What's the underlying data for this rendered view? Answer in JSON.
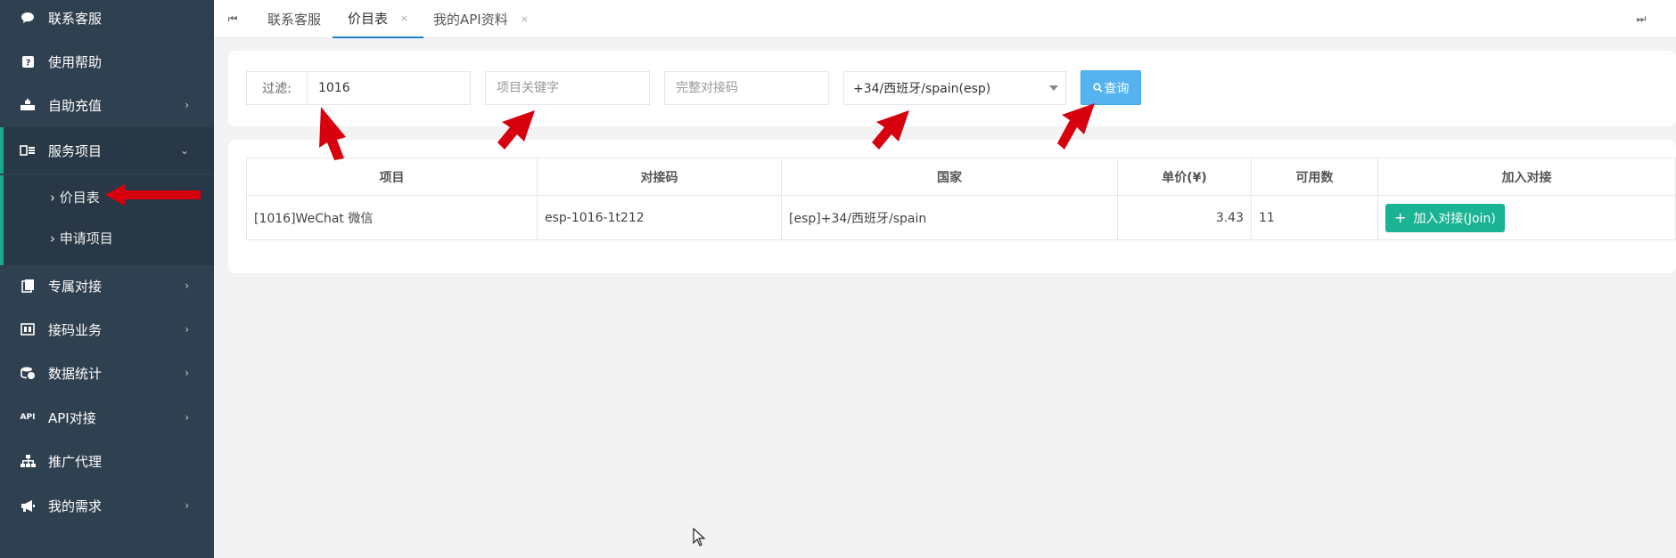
{
  "sidebar": {
    "items": [
      {
        "label": "联系客服",
        "icon": "chat-icon"
      },
      {
        "label": "使用帮助",
        "icon": "help-icon"
      },
      {
        "label": "自助充值",
        "icon": "recharge-icon"
      },
      {
        "label": "服务项目",
        "icon": "service-icon"
      },
      {
        "label": "专属对接",
        "icon": "dedicated-icon"
      },
      {
        "label": "接码业务",
        "icon": "code-icon"
      },
      {
        "label": "数据统计",
        "icon": "stats-icon"
      },
      {
        "label": "API对接",
        "icon": "api-icon"
      },
      {
        "label": "推广代理",
        "icon": "agent-icon"
      },
      {
        "label": "我的需求",
        "icon": "megaphone-icon"
      }
    ],
    "subitems": [
      {
        "label": "价目表"
      },
      {
        "label": "申请项目"
      }
    ]
  },
  "tabs": [
    {
      "label": "联系客服"
    },
    {
      "label": "价目表"
    },
    {
      "label": "我的API资料"
    }
  ],
  "filter": {
    "label": "过滤:",
    "filter_value": "1016",
    "keyword_placeholder": "项目关键字",
    "code_placeholder": "完整对接码",
    "country_selected": "+34/西班牙/spain(esp)",
    "query_label": "查询"
  },
  "table": {
    "headers": [
      "项目",
      "对接码",
      "国家",
      "单价(¥)",
      "可用数",
      "加入对接"
    ],
    "rows": [
      {
        "project": "[1016]WeChat 微信",
        "code": "esp-1016-1t212",
        "country": "[esp]+34/西班牙/spain",
        "price": "3.43",
        "available": "11",
        "join_label": "加入对接(Join)"
      }
    ]
  },
  "colors": {
    "sidebar_bg": "#2f4050",
    "accent_green": "#1ab394",
    "query_blue": "#55b3f0",
    "arrow_red": "#d7000f"
  }
}
